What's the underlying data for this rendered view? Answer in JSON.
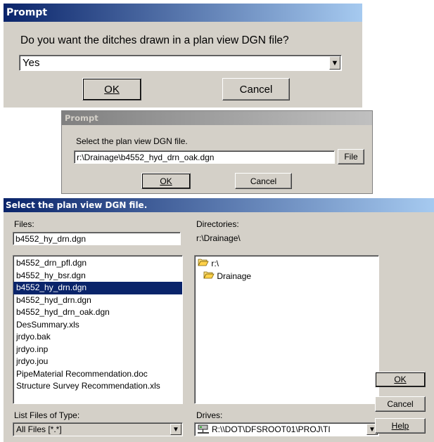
{
  "prompt1": {
    "title": "Prompt",
    "question": "Do you want the ditches drawn in a plan view DGN file?",
    "dropdown_value": "Yes",
    "ok_label": "OK",
    "cancel_label": "Cancel"
  },
  "prompt2": {
    "title": "Prompt",
    "instruction": "Select the plan view DGN file.",
    "path_value": "r:\\Drainage\\b4552_hyd_drn_oak.dgn",
    "file_button": "File",
    "ok_label": "OK",
    "cancel_label": "Cancel"
  },
  "file_dialog": {
    "title": "Select the plan view DGN file.",
    "files_label": "Files:",
    "filename_value": "b4552_hy_drn.dgn",
    "files": [
      "b4552_drn_pfl.dgn",
      "b4552_hy_bsr.dgn",
      "b4552_hy_drn.dgn",
      "b4552_hyd_drn.dgn",
      "b4552_hyd_drn_oak.dgn",
      "DesSummary.xls",
      "jrdyo.bak",
      "jrdyo.inp",
      "jrdyo.jou",
      "PipeMaterial Recommendation.doc",
      "Structure Survey Recommendation.xls"
    ],
    "selected_file": "b4552_hy_drn.dgn",
    "directories_label": "Directories:",
    "current_directory": "r:\\Drainage\\",
    "directories": [
      "r:\\",
      "Drainage"
    ],
    "list_type_label": "List Files of Type:",
    "list_type_value": "All Files [*.*]",
    "drives_label": "Drives:",
    "drive_value": "R:\\\\DOT\\DFSROOT01\\PROJ\\TI",
    "ok_label": "OK",
    "cancel_label": "Cancel",
    "help_label": "Help"
  },
  "colors": {
    "title_active": "#0a246a",
    "title_inactive": "#808080",
    "dialog_face": "#d4d0c8",
    "selection": "#0a246a"
  }
}
